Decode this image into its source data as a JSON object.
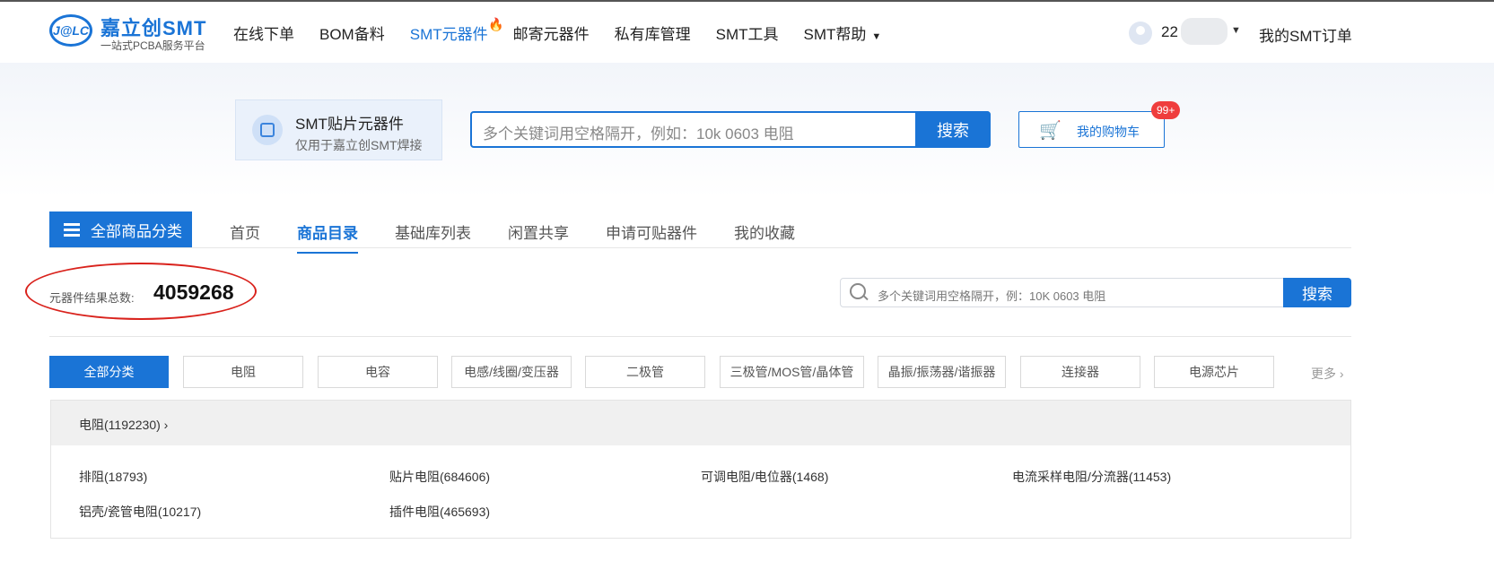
{
  "header": {
    "logo_badge": "J@LC",
    "logo_name": "嘉立创SMT",
    "logo_sub": "一站式PCBA服务平台",
    "nav": [
      {
        "label": "在线下单"
      },
      {
        "label": "BOM备料"
      },
      {
        "label": "SMT元器件"
      },
      {
        "label": "邮寄元器件"
      },
      {
        "label": "私有库管理"
      },
      {
        "label": "SMT工具"
      },
      {
        "label": "SMT帮助"
      }
    ],
    "user": "22",
    "my_orders": "我的SMT订单"
  },
  "smt_card": {
    "title": "SMT贴片元器件",
    "subtitle": "仅用于嘉立创SMT焊接"
  },
  "main_search": {
    "placeholder": "多个关键词用空格隔开，例如：10k 0603 电阻",
    "button": "搜索"
  },
  "cart": {
    "label": "我的购物车",
    "badge": "99+"
  },
  "all_categories": "全部商品分类",
  "tabs": [
    "首页",
    "商品目录",
    "基础库列表",
    "闲置共享",
    "申请可贴器件",
    "我的收藏"
  ],
  "total": {
    "label": "元器件结果总数:",
    "value": "4059268"
  },
  "sub_search": {
    "placeholder": "多个关键词用空格隔开，例：10K 0603 电阻",
    "button": "搜索"
  },
  "categories": [
    "全部分类",
    "电阻",
    "电容",
    "电感/线圈/变压器",
    "二极管",
    "三极管/MOS管/晶体管",
    "晶振/振荡器/谐振器",
    "连接器",
    "电源芯片"
  ],
  "more": "更多 ›",
  "panel": {
    "heading": "电阻(1192230)  ›",
    "items": [
      "排阻(18793)",
      "贴片电阻(684606)",
      "可调电阻/电位器(1468)",
      "电流采样电阻/分流器(11453)",
      "铝壳/瓷管电阻(10217)",
      "插件电阻(465693)"
    ]
  }
}
